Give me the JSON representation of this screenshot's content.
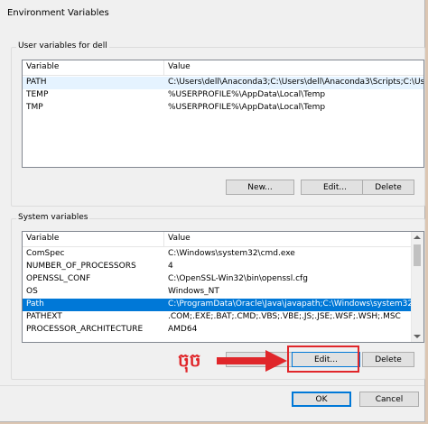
{
  "window": {
    "title": "Environment Variables"
  },
  "user_vars": {
    "label": "User variables for dell",
    "columns": [
      "Variable",
      "Value"
    ],
    "rows": [
      {
        "variable": "PATH",
        "value": "C:\\Users\\dell\\Anaconda3;C:\\Users\\dell\\Anaconda3\\Scripts;C:\\Users..."
      },
      {
        "variable": "TEMP",
        "value": "%USERPROFILE%\\AppData\\Local\\Temp"
      },
      {
        "variable": "TMP",
        "value": "%USERPROFILE%\\AppData\\Local\\Temp"
      }
    ],
    "buttons": {
      "new": "New...",
      "edit": "Edit...",
      "delete": "Delete"
    }
  },
  "system_vars": {
    "label": "System variables",
    "columns": [
      "Variable",
      "Value"
    ],
    "rows": [
      {
        "variable": "ComSpec",
        "value": "C:\\Windows\\system32\\cmd.exe"
      },
      {
        "variable": "NUMBER_OF_PROCESSORS",
        "value": "4"
      },
      {
        "variable": "OPENSSL_CONF",
        "value": "C:\\OpenSSL-Win32\\bin\\openssl.cfg"
      },
      {
        "variable": "OS",
        "value": "Windows_NT"
      },
      {
        "variable": "Path",
        "value": "C:\\ProgramData\\Oracle\\Java\\javapath;C:\\Windows\\system32;C:\\Win..."
      },
      {
        "variable": "PATHEXT",
        "value": ".COM;.EXE;.BAT;.CMD;.VBS;.VBE;.JS;.JSE;.WSF;.WSH;.MSC"
      },
      {
        "variable": "PROCESSOR_ARCHITECTURE",
        "value": "AMD64"
      }
    ],
    "buttons": {
      "edit": "Edit...",
      "delete": "Delete"
    }
  },
  "dialog_buttons": {
    "ok": "OK",
    "cancel": "Cancel"
  },
  "annotation": {
    "text": "ចុច",
    "color": "#e0262a"
  },
  "colors": {
    "selection": "#0078d7",
    "accent_border": "#0078d7"
  }
}
